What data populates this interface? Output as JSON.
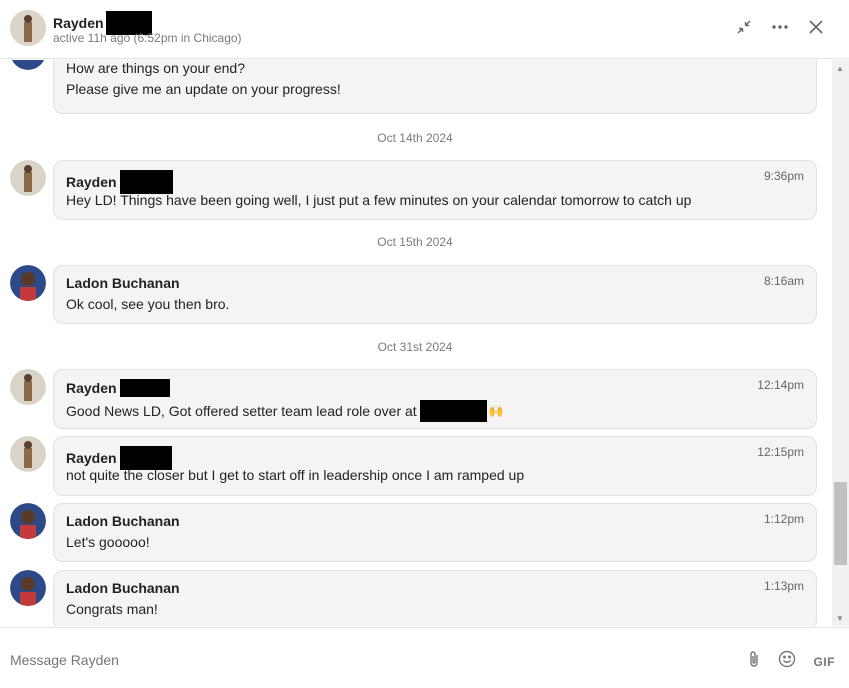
{
  "header": {
    "name": "Rayden",
    "status": "active 11h ago (6:52pm in Chicago)"
  },
  "messages": [
    {
      "lines": [
        "How are things on your end?",
        "Please give me an update on your progress!"
      ]
    },
    {
      "date": "Oct 14th 2024"
    },
    {
      "sender": "Rayden",
      "time": "9:36pm",
      "text": "Hey LD! Things have been going well, I just put a few minutes on your calendar tomorrow to catch up"
    },
    {
      "date": "Oct 15th 2024"
    },
    {
      "sender": "Ladon Buchanan",
      "time": "8:16am",
      "text": "Ok cool, see you then bro."
    },
    {
      "date": "Oct 31st 2024"
    },
    {
      "sender": "Rayden",
      "time": "12:14pm",
      "text": "Good News LD, Got offered setter team lead role over at",
      "emoji": "🙌"
    },
    {
      "sender": "Rayden",
      "time": "12:15pm",
      "text": "not quite the closer but I get to start off in leadership once I am ramped up"
    },
    {
      "sender": "Ladon Buchanan",
      "time": "1:12pm",
      "text": "Let's gooooo!"
    },
    {
      "sender": "Ladon Buchanan",
      "time": "1:13pm",
      "text": "Congrats man!"
    }
  ],
  "footer": {
    "placeholder": "Message Rayden",
    "gif_label": "GIF"
  },
  "icons": [
    "minimize-icon",
    "more-icon",
    "close-icon",
    "attach-icon",
    "emoji-icon"
  ]
}
